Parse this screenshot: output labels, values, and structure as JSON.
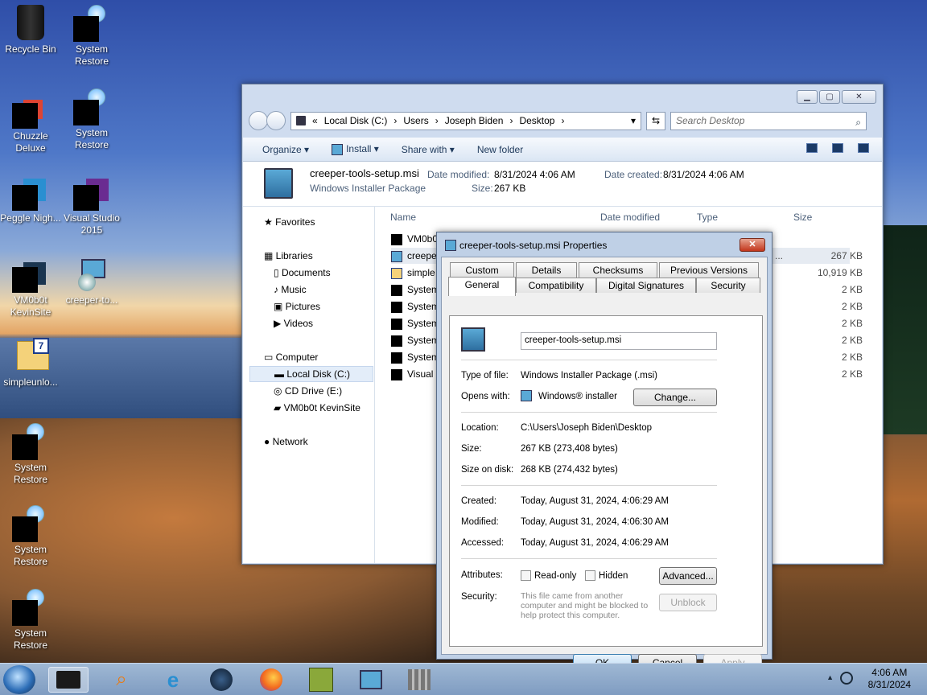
{
  "desktop": {
    "icons": [
      {
        "label": "Recycle Bin"
      },
      {
        "label": "System Restore"
      },
      {
        "label": "Chuzzle Deluxe"
      },
      {
        "label": "System Restore"
      },
      {
        "label": "Peggle Nigh..."
      },
      {
        "label": "Visual Studio 2015"
      },
      {
        "label": "VM0b0t KevinSite"
      },
      {
        "label": "creeper-to..."
      },
      {
        "label": "simpleunlo..."
      },
      {
        "label": "System Restore"
      },
      {
        "label": "System Restore"
      },
      {
        "label": "System Restore"
      }
    ]
  },
  "explorer": {
    "breadcrumb": [
      "«",
      "Local Disk (C:)",
      "›",
      "Users",
      "›",
      "Joseph Biden",
      "›",
      "Desktop",
      "›"
    ],
    "search_placeholder": "Search Desktop",
    "commands": {
      "organize": "Organize ▾",
      "install": "Install ▾",
      "share": "Share with ▾",
      "new_folder": "New folder"
    },
    "details": {
      "name": "creeper-tools-setup.msi",
      "kind": "Windows Installer Package",
      "modified_label": "Date modified:",
      "modified": "8/31/2024 4:06 AM",
      "created_label": "Date created:",
      "created": "8/31/2024 4:06 AM",
      "size_label": "Size:",
      "size": "267 KB"
    },
    "nav": {
      "favorites": "Favorites",
      "libraries": "Libraries",
      "documents": "Documents",
      "music": "Music",
      "pictures": "Pictures",
      "videos": "Videos",
      "computer": "Computer",
      "local_disk": "Local Disk (C:)",
      "cd_drive": "CD Drive (E:)",
      "vm": "VM0b0t KevinSite",
      "network": "Network"
    },
    "columns": {
      "name": "Name",
      "date": "Date modified",
      "type": "Type",
      "size": "Size"
    },
    "rows": [
      {
        "name": "VM0b0",
        "size": ""
      },
      {
        "name": "creeper",
        "size": "267 KB"
      },
      {
        "name": "simple",
        "size": "10,919 KB"
      },
      {
        "name": "System",
        "size": "2 KB"
      },
      {
        "name": "System",
        "size": "2 KB"
      },
      {
        "name": "System",
        "size": "2 KB"
      },
      {
        "name": "System",
        "size": "2 KB"
      },
      {
        "name": "System",
        "size": "2 KB"
      },
      {
        "name": "Visual S",
        "size": "2 KB"
      }
    ],
    "ellipsis": "..."
  },
  "dialog": {
    "title": "creeper-tools-setup.msi Properties",
    "close": "✕",
    "tabs": {
      "custom": "Custom",
      "details": "Details",
      "checksums": "Checksums",
      "previous": "Previous Versions",
      "general": "General",
      "compat": "Compatibility",
      "signatures": "Digital Signatures",
      "security": "Security"
    },
    "filename": "creeper-tools-setup.msi",
    "type_label": "Type of file:",
    "type": "Windows Installer Package (.msi)",
    "opens_label": "Opens with:",
    "opens": "Windows® installer",
    "change": "Change...",
    "location_label": "Location:",
    "location": "C:\\Users\\Joseph Biden\\Desktop",
    "size_label": "Size:",
    "size": "267 KB (273,408 bytes)",
    "sod_label": "Size on disk:",
    "sod": "268 KB (274,432 bytes)",
    "created_label": "Created:",
    "created": "Today, August 31, 2024, 4:06:29 AM",
    "modified_label": "Modified:",
    "modified": "Today, August 31, 2024, 4:06:30 AM",
    "accessed_label": "Accessed:",
    "accessed": "Today, August 31, 2024, 4:06:29 AM",
    "attr_label": "Attributes:",
    "readonly": "Read-only",
    "hidden": "Hidden",
    "advanced": "Advanced...",
    "security_label": "Security:",
    "security_text": "This file came from another computer and might be blocked to help protect this computer.",
    "unblock": "Unblock",
    "ok": "OK",
    "cancel": "Cancel",
    "apply": "Apply"
  },
  "taskbar": {
    "time": "4:06 AM",
    "date": "8/31/2024",
    "tray_arrow": "▲"
  }
}
